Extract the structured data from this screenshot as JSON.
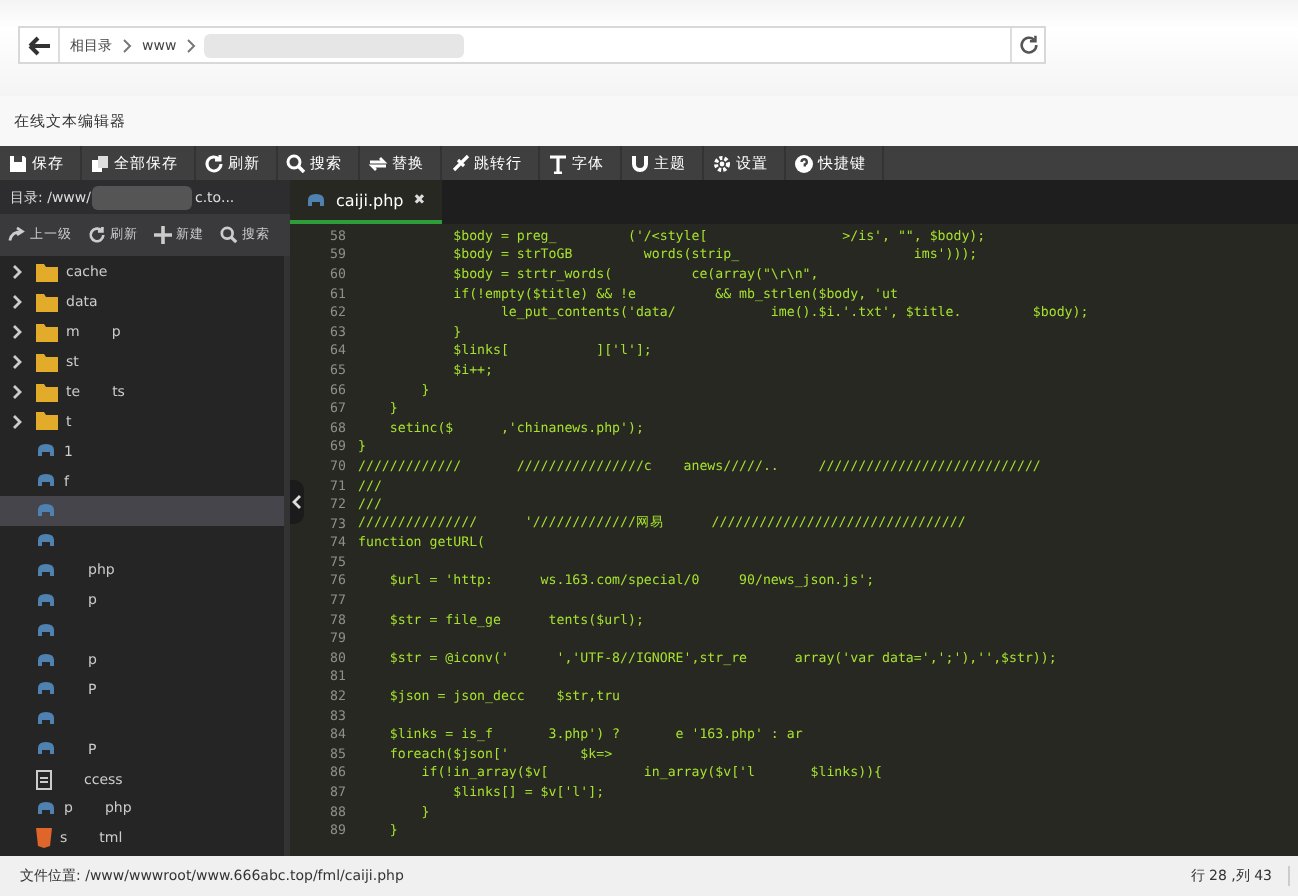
{
  "address_bar": {
    "crumbs": [
      "相目录",
      "www"
    ]
  },
  "page_title": "在线文本编辑器",
  "toolbar": [
    "保存",
    "全部保存",
    "刷新",
    "搜索",
    "替换",
    "跳转行",
    "字体",
    "主题",
    "设置",
    "快捷键"
  ],
  "sidebar": {
    "path": "目录: /www/",
    "path_end": "c.to...",
    "actions": [
      "上一级",
      "刷新",
      "新建",
      "搜索"
    ],
    "items": [
      {
        "kind": "folder",
        "name": "cache",
        "selected": false
      },
      {
        "kind": "folder",
        "name": "data",
        "selected": false
      },
      {
        "kind": "folder",
        "name": "m",
        "name_end": "p",
        "selected": false
      },
      {
        "kind": "folder",
        "name": "st",
        "selected": false
      },
      {
        "kind": "folder",
        "name": "te",
        "name_end": "ts",
        "selected": false
      },
      {
        "kind": "folder",
        "name": "t",
        "selected": false
      },
      {
        "kind": "php",
        "name": "1",
        "selected": false
      },
      {
        "kind": "php",
        "name": "f",
        "selected": false
      },
      {
        "kind": "php",
        "selected": true
      },
      {
        "kind": "php",
        "selected": false
      },
      {
        "kind": "php",
        "name_end": "php",
        "selected": false
      },
      {
        "kind": "php",
        "name_end": "p",
        "selected": false
      },
      {
        "kind": "php",
        "selected": false
      },
      {
        "kind": "php",
        "name_end": "p",
        "selected": false
      },
      {
        "kind": "php",
        "name_end": "P",
        "selected": false
      },
      {
        "kind": "php",
        "selected": false
      },
      {
        "kind": "php",
        "name_end": "P",
        "selected": false
      },
      {
        "kind": "file",
        "name_end": "ccess",
        "selected": false
      },
      {
        "kind": "php",
        "name": "p",
        "name_end": "php",
        "selected": false
      },
      {
        "kind": "html",
        "name": "s",
        "name_end": "tml",
        "selected": false
      }
    ]
  },
  "tab": {
    "label": "caiji.php",
    "close": "✖"
  },
  "code": [
    {
      "n": "58",
      "text": "            $body = preg_         ('/<style[                 >/is', \"\", $body);"
    },
    {
      "n": "59",
      "text": "            $body = strToGB         words(strip_                      ims')));"
    },
    {
      "n": "60",
      "text": "            $body = strtr_words(          ce(array(\"\\r\\n\", "
    },
    {
      "n": "61",
      "text": "            if(!empty($title) && !e          && mb_strlen($body, 'ut"
    },
    {
      "n": "62",
      "text": "                  le_put_contents('data/            ime().$i.'.txt', $title.         $body);"
    },
    {
      "n": "63",
      "text": "            }"
    },
    {
      "n": "64",
      "text": "            $links[           ]['l'];"
    },
    {
      "n": "65",
      "text": "            $i++;"
    },
    {
      "n": "66",
      "text": "        }"
    },
    {
      "n": "67",
      "text": "    }"
    },
    {
      "n": "68",
      "text": "    setinc($      ,'chinanews.php');"
    },
    {
      "n": "69",
      "text": "}"
    },
    {
      "n": "70",
      "text": "/////////////       ////////////////c    anews/////..     ////////////////////////////"
    },
    {
      "n": "71",
      "text": "///"
    },
    {
      "n": "72",
      "text": "///"
    },
    {
      "n": "73",
      "text": "///////////////      '/////////////网易      ////////////////////////////////"
    },
    {
      "n": "74",
      "text": "function getURL("
    },
    {
      "n": "75"
    },
    {
      "n": "76",
      "text": "    $url = 'http:      ws.163.com/special/0     90/news_json.js';"
    },
    {
      "n": "77"
    },
    {
      "n": "78",
      "text": "    $str = file_ge      tents($url);"
    },
    {
      "n": "79"
    },
    {
      "n": "80",
      "text": "    $str = @iconv('      ','UTF-8//IGNORE',str_re      array('var data=',';'),'',$str));"
    },
    {
      "n": "81"
    },
    {
      "n": "82",
      "text": "    $json = json_decc    $str,tru"
    },
    {
      "n": "83"
    },
    {
      "n": "84",
      "text": "    $links = is_f       3.php') ?       e '163.php' : ar"
    },
    {
      "n": "85",
      "text": "    foreach($json['         $k=>"
    },
    {
      "n": "86",
      "text": "        if(!in_array($v[            in_array($v['l       $links)){"
    },
    {
      "n": "87",
      "text": "            $links[] = $v['l'];"
    },
    {
      "n": "88",
      "text": "        }"
    },
    {
      "n": "89",
      "text": "    }"
    }
  ],
  "status_bar": {
    "file": "文件位置: /www/wwwroot/www.666abc.top/fml/caiji.php",
    "position": "行 28 ,列 43"
  }
}
